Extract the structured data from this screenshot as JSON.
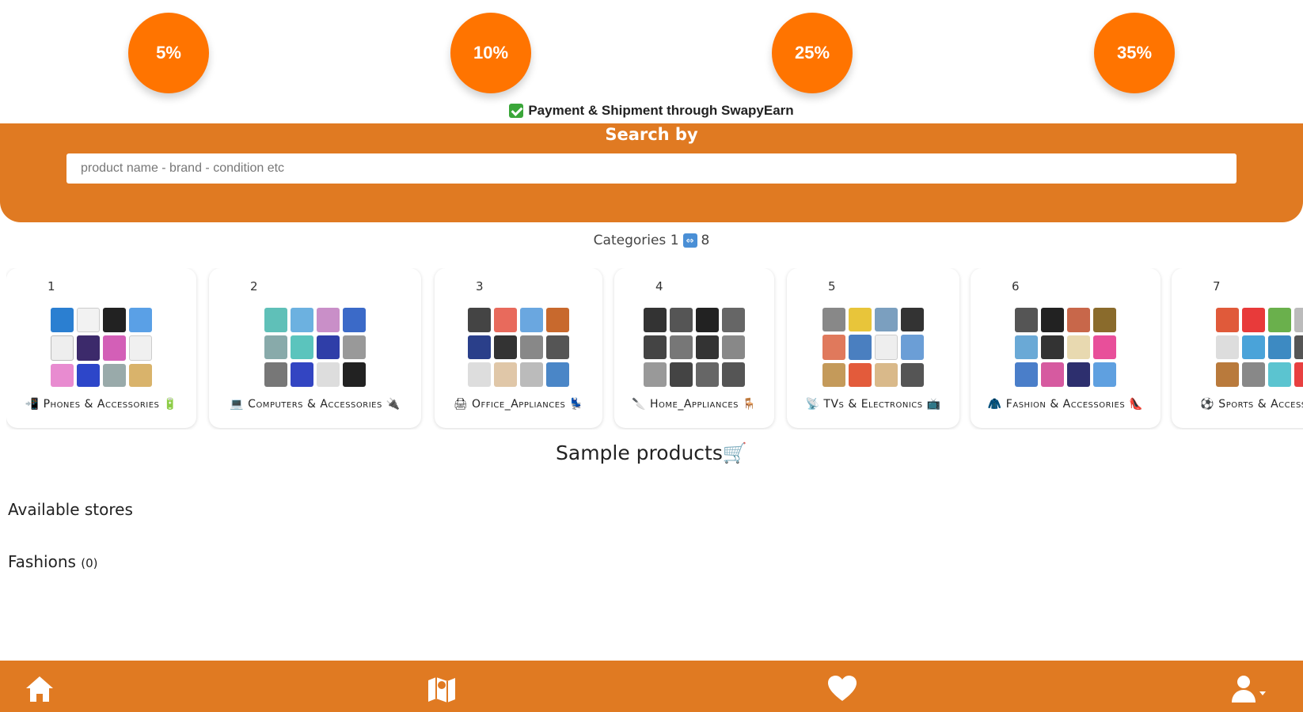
{
  "discounts": [
    "5%",
    "10%",
    "25%",
    "35%"
  ],
  "payment_note": "Payment & Shipment through SwapyEarn",
  "search": {
    "title": "Search by",
    "placeholder": "product name - brand - condition etc"
  },
  "categories_caption": {
    "text_before": "Categories 1",
    "text_after": "8"
  },
  "categories": [
    {
      "num": "1",
      "label": "📲 Phones & Accessories 🔋"
    },
    {
      "num": "2",
      "label": "💻 Computers & Accessories 🔌"
    },
    {
      "num": "3",
      "label": "🖨 Office_Appliances 💺"
    },
    {
      "num": "4",
      "label": "🔪 Home_Appliances 🪑"
    },
    {
      "num": "5",
      "label": "📡 TVs & Electronics 📺"
    },
    {
      "num": "6",
      "label": "🧥 Fashion & Accessories 👠"
    },
    {
      "num": "7",
      "label": "⚽ Sports & Accessories"
    }
  ],
  "sample_products_title": "Sample products🛒",
  "available_stores_title": "Available stores",
  "fashions": {
    "label": "Fashions",
    "count": "(0)"
  },
  "colors": {
    "orange": "#ff7400",
    "band": "#e07a22"
  }
}
